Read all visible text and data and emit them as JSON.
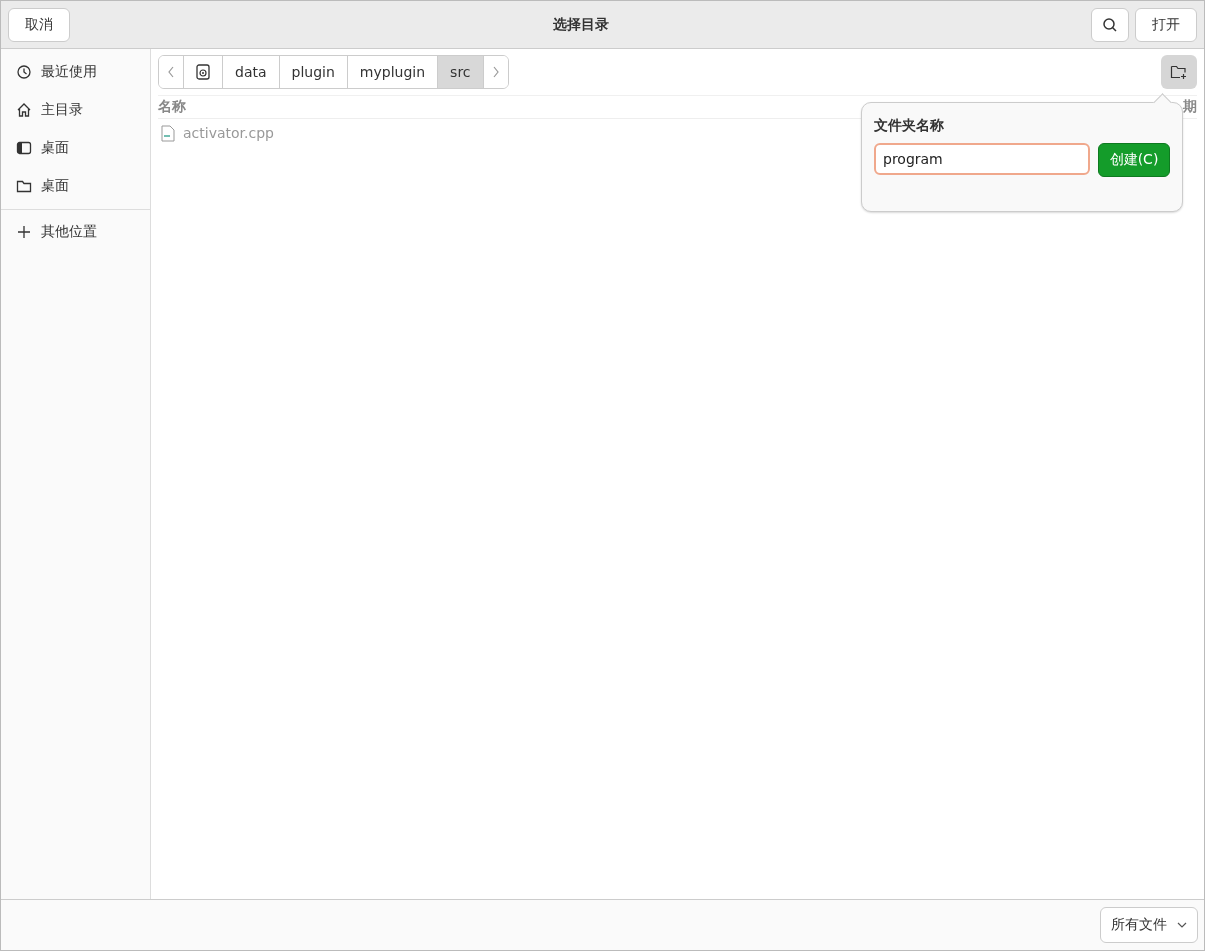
{
  "window": {
    "title": "选择目录",
    "cancel": "取消",
    "open": "打开"
  },
  "sidebar": {
    "items": [
      {
        "label": "最近使用",
        "kind": "recent",
        "selected": false
      },
      {
        "label": "主目录",
        "kind": "home",
        "selected": false
      },
      {
        "label": "桌面",
        "kind": "desktop",
        "selected": false
      },
      {
        "label": "桌面",
        "kind": "folder",
        "selected": false
      }
    ],
    "other": "其他位置"
  },
  "path": [
    {
      "label": "data",
      "selected": false
    },
    {
      "label": "plugin",
      "selected": false
    },
    {
      "label": "myplugin",
      "selected": false
    },
    {
      "label": "src",
      "selected": true
    }
  ],
  "columns": {
    "name": "名称",
    "column_4": "期"
  },
  "files": [
    {
      "name": "activator.cpp"
    }
  ],
  "new_folder": {
    "label": "文件夹名称",
    "value": "program",
    "create": "创建(C)"
  },
  "filter": "所有文件"
}
